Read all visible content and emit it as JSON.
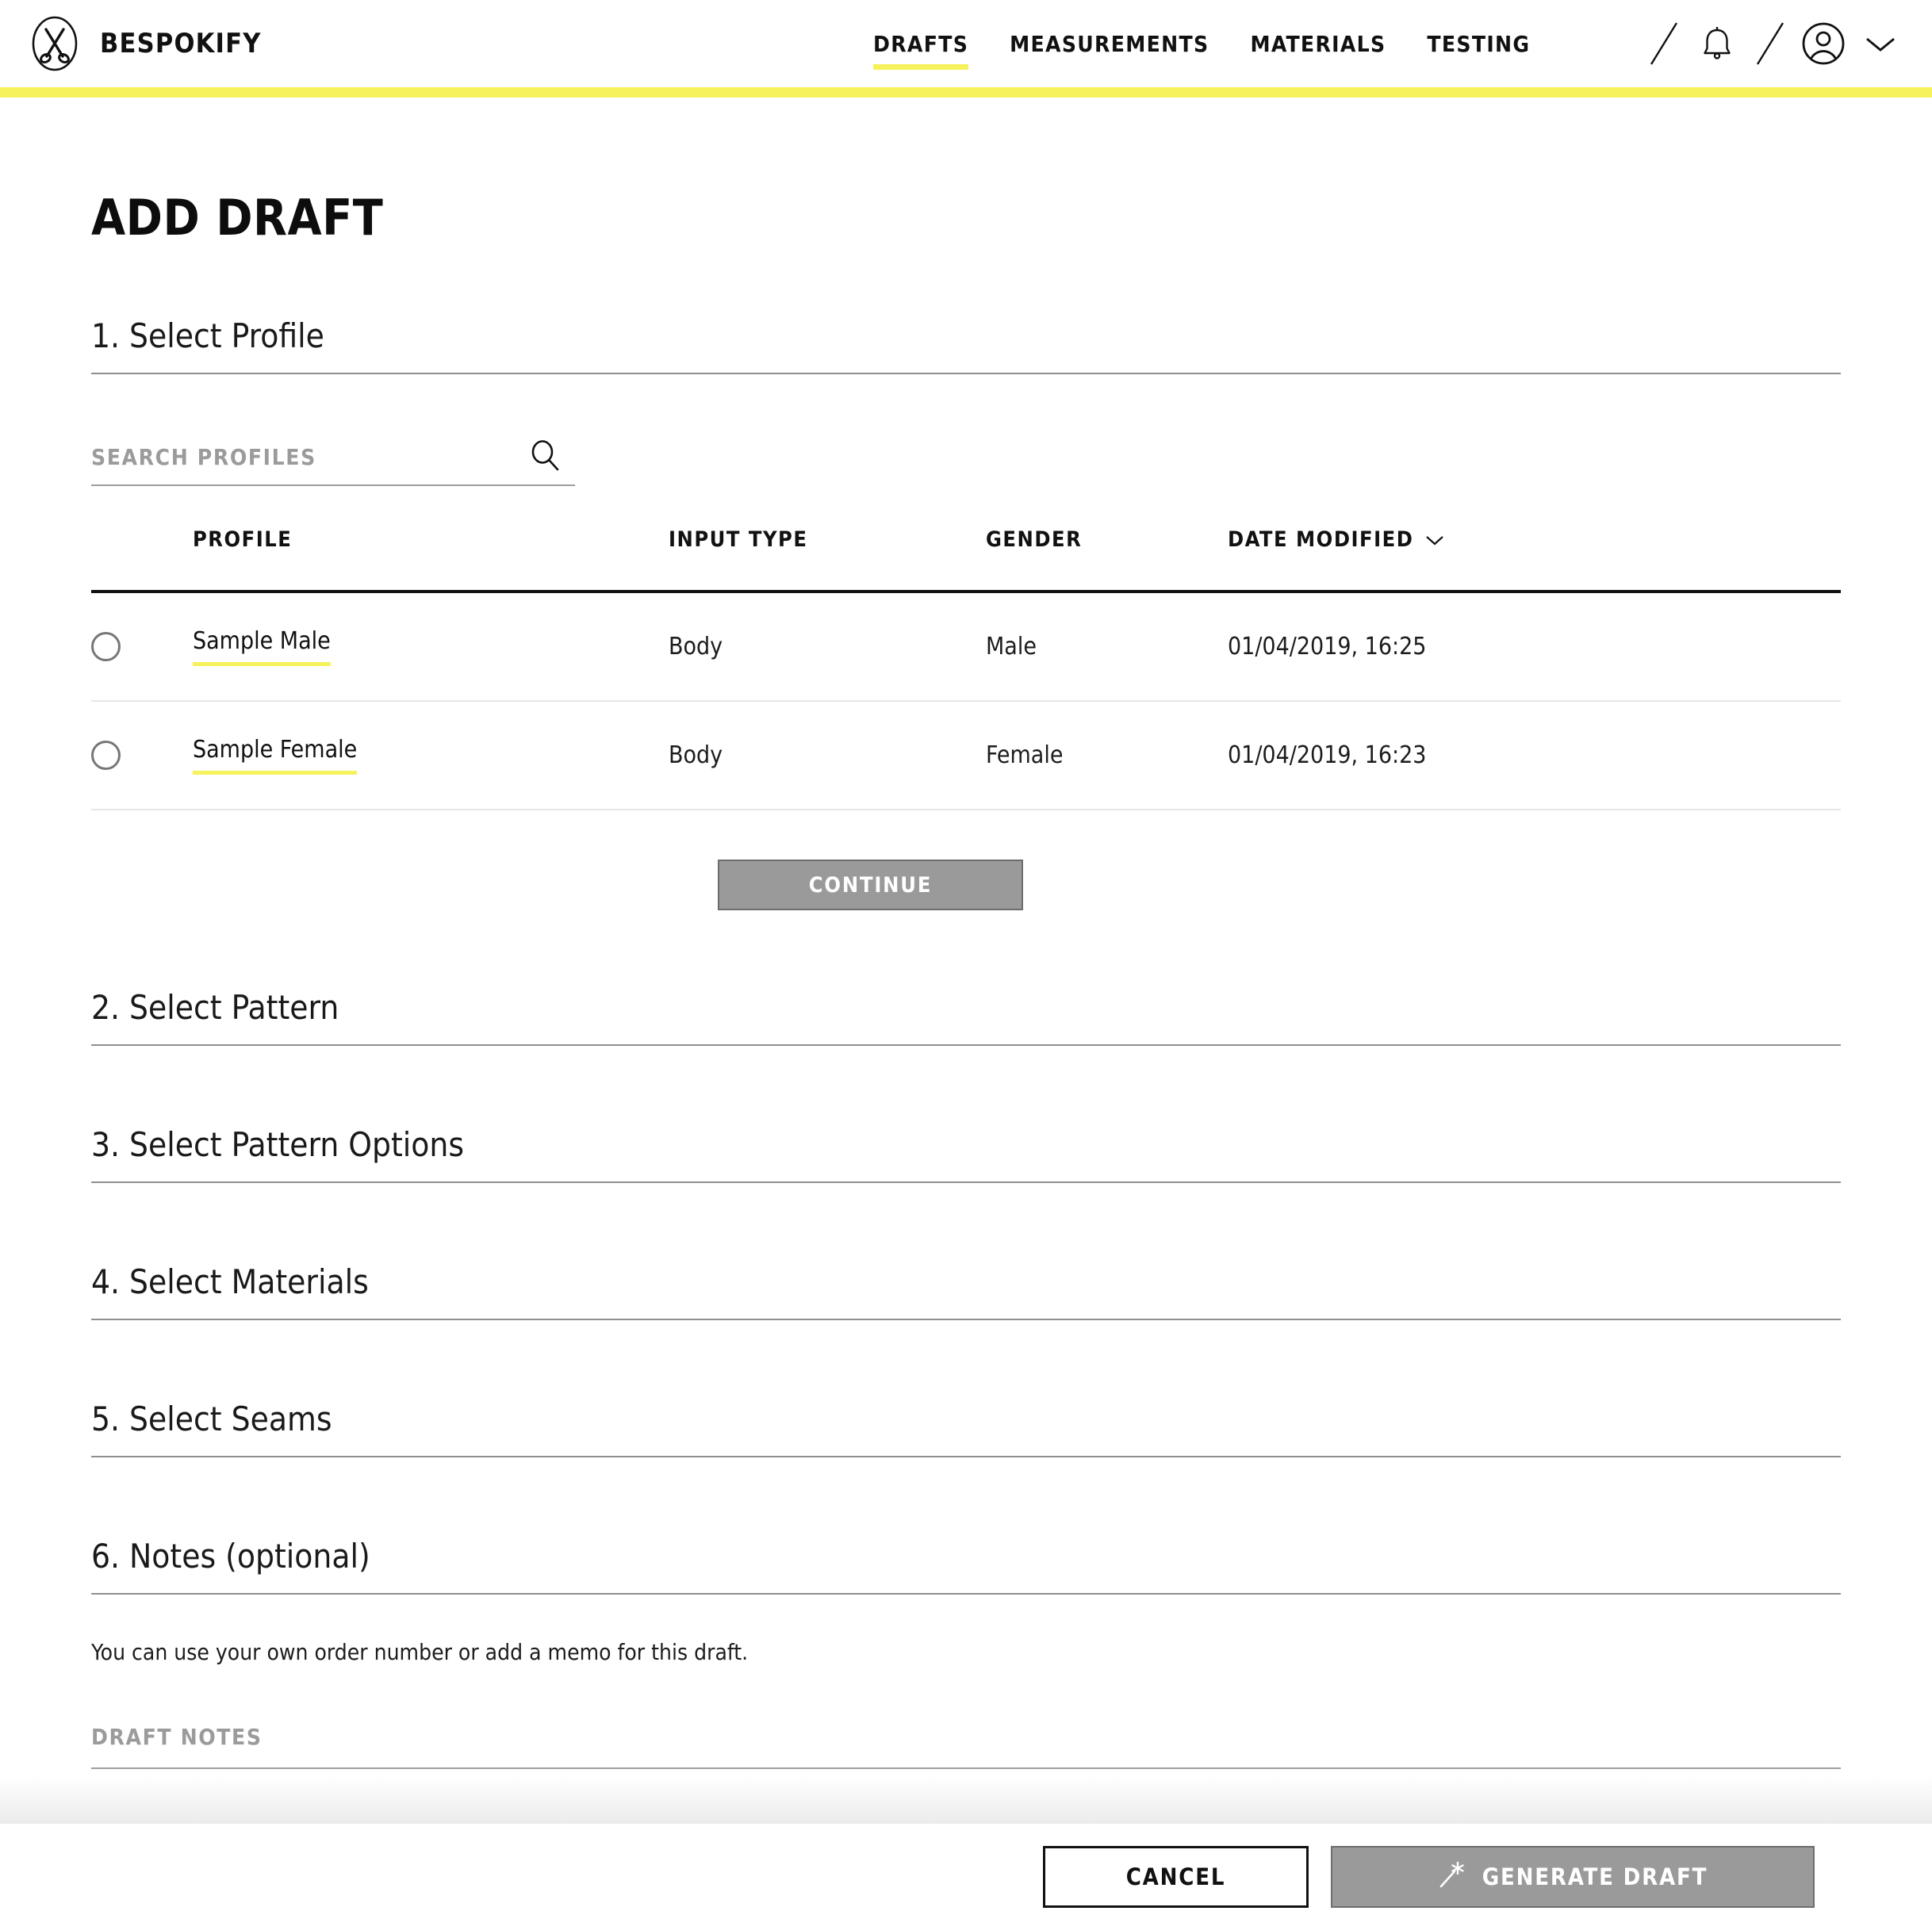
{
  "brand": {
    "name": "BESPOKIFY",
    "logo_icon": "scissors-icon"
  },
  "nav": {
    "items": [
      {
        "label": "DRAFTS",
        "active": true
      },
      {
        "label": "MEASUREMENTS",
        "active": false
      },
      {
        "label": "MATERIALS",
        "active": false
      },
      {
        "label": "TESTING",
        "active": false
      }
    ],
    "icons": [
      "divider-slash-icon",
      "bell-icon",
      "divider-slash-icon",
      "user-avatar-icon",
      "chevron-down-icon"
    ]
  },
  "page": {
    "title": "ADD DRAFT"
  },
  "sections": [
    {
      "id": "select-profile",
      "title": "1. Select Profile"
    },
    {
      "id": "select-pattern",
      "title": "2. Select Pattern"
    },
    {
      "id": "select-pattern-options",
      "title": "3. Select Pattern Options"
    },
    {
      "id": "select-materials",
      "title": "4. Select Materials"
    },
    {
      "id": "select-seams",
      "title": "5. Select Seams"
    },
    {
      "id": "notes",
      "title": "6. Notes (optional)"
    }
  ],
  "search": {
    "placeholder": "SEARCH PROFILES",
    "value": "",
    "icon": "search-icon"
  },
  "profiles_table": {
    "columns": [
      "PROFILE",
      "INPUT TYPE",
      "GENDER",
      "DATE MODIFIED"
    ],
    "sort_column": "DATE MODIFIED",
    "sort_icon": "chevron-down-icon",
    "rows": [
      {
        "selected": false,
        "profile": "Sample Male",
        "input_type": "Body",
        "gender": "Male",
        "date_modified": "01/04/2019, 16:25"
      },
      {
        "selected": false,
        "profile": "Sample Female",
        "input_type": "Body",
        "gender": "Female",
        "date_modified": "01/04/2019, 16:23"
      }
    ]
  },
  "continue_button": {
    "label": "CONTINUE",
    "disabled": true
  },
  "notes": {
    "hint": "You can use your own order number or add a memo for this draft.",
    "placeholder": "DRAFT NOTES",
    "value": ""
  },
  "footer": {
    "cancel_label": "CANCEL",
    "generate_label": "GENERATE DRAFT",
    "generate_icon": "magic-wand-icon",
    "generate_disabled": true
  },
  "colors": {
    "accent_yellow": "#f6f25c",
    "text_primary": "#111111",
    "text_muted": "#9b9b9b",
    "disabled_gray": "#9a9a9a",
    "rule_gray": "#8f8f8f",
    "row_divider": "#e6e6e6"
  }
}
